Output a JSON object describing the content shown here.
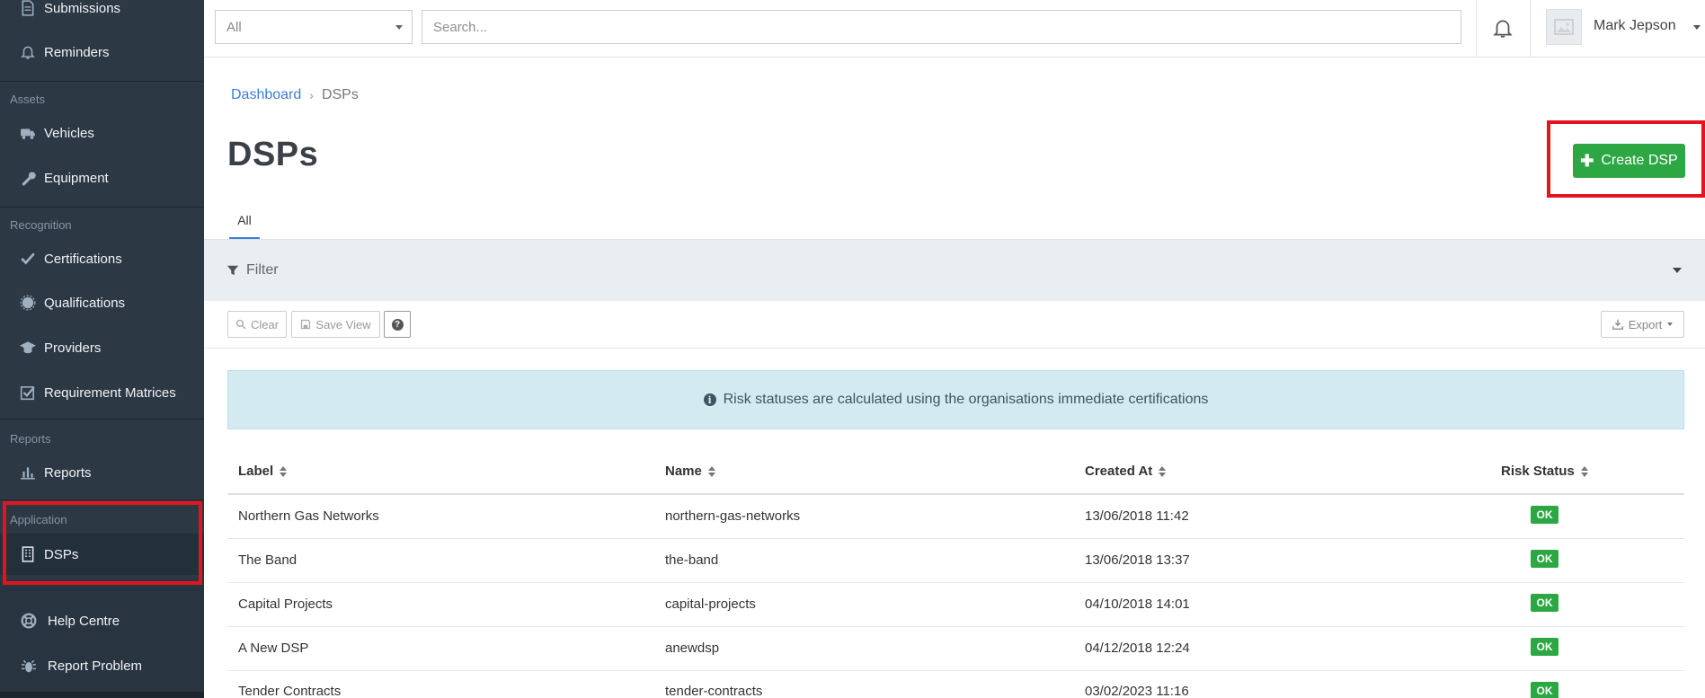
{
  "sidebar": {
    "items": [
      {
        "label": "Submissions",
        "icon": "document-icon"
      },
      {
        "label": "Reminders",
        "icon": "bell-icon"
      },
      {
        "label": "Vehicles",
        "icon": "truck-icon"
      },
      {
        "label": "Equipment",
        "icon": "wrench-icon"
      },
      {
        "label": "Certifications",
        "icon": "check-icon"
      },
      {
        "label": "Qualifications",
        "icon": "badge-icon"
      },
      {
        "label": "Providers",
        "icon": "graduation-cap-icon"
      },
      {
        "label": "Requirement Matrices",
        "icon": "checkbox-icon"
      },
      {
        "label": "Reports",
        "icon": "bar-chart-icon"
      },
      {
        "label": "DSPs",
        "icon": "building-icon"
      }
    ],
    "sections": {
      "assets": "Assets",
      "recognition": "Recognition",
      "reports": "Reports",
      "application": "Application"
    },
    "bottom": [
      {
        "label": "Help Centre",
        "icon": "life-ring-icon"
      },
      {
        "label": "Report Problem",
        "icon": "bug-icon"
      }
    ]
  },
  "topbar": {
    "select_value": "All",
    "search_placeholder": "Search...",
    "user_name": "Mark Jepson"
  },
  "breadcrumb": {
    "home": "Dashboard",
    "current": "DSPs"
  },
  "page": {
    "title": "DSPs",
    "create_button": "Create DSP",
    "tab_all": "All",
    "filter_label": "Filter",
    "clear_label": "Clear",
    "save_view_label": "Save View",
    "export_label": "Export",
    "info_message": "Risk statuses are calculated using the organisations immediate certifications"
  },
  "table": {
    "columns": [
      "Label",
      "Name",
      "Created At",
      "Risk Status"
    ],
    "rows": [
      {
        "label": "Northern Gas Networks",
        "name": "northern-gas-networks",
        "created_at": "13/06/2018 11:42",
        "risk": "OK"
      },
      {
        "label": "The Band",
        "name": "the-band",
        "created_at": "13/06/2018 13:37",
        "risk": "OK"
      },
      {
        "label": "Capital Projects",
        "name": "capital-projects",
        "created_at": "04/10/2018 14:01",
        "risk": "OK"
      },
      {
        "label": "A New DSP",
        "name": "anewdsp",
        "created_at": "04/12/2018 12:24",
        "risk": "OK"
      },
      {
        "label": "Tender Contracts",
        "name": "tender-contracts",
        "created_at": "03/02/2023 11:16",
        "risk": "OK"
      }
    ]
  },
  "colors": {
    "sidebar_bg": "#2c3844",
    "accent_green": "#2da743",
    "link_blue": "#3b7ddd",
    "highlight_red": "#e3141f",
    "info_bg": "#d3ebf0"
  }
}
